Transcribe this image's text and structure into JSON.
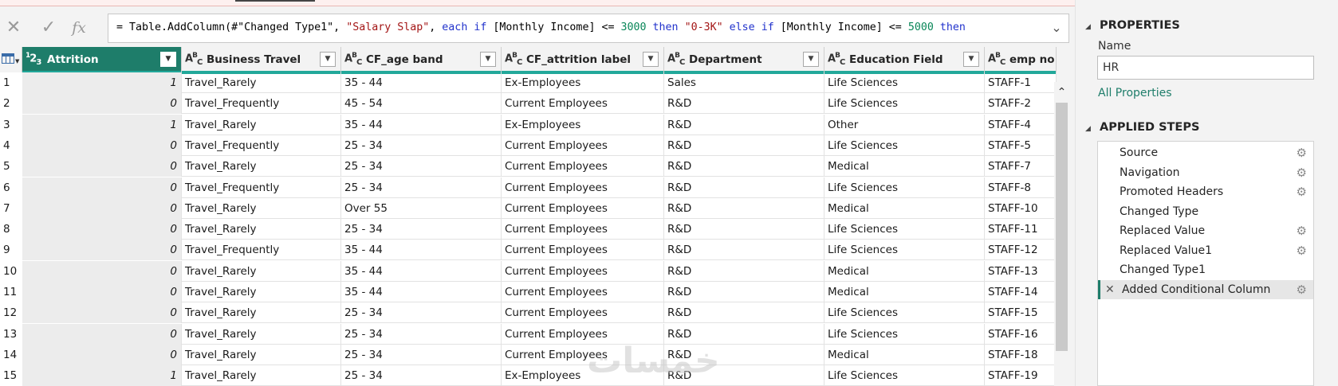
{
  "formula": {
    "segments": [
      {
        "t": "= Table.AddColumn(#\"Changed Type1\", ",
        "c": ""
      },
      {
        "t": "\"Salary Slap\"",
        "c": "str"
      },
      {
        "t": ", ",
        "c": ""
      },
      {
        "t": "each",
        "c": "kw"
      },
      {
        "t": " ",
        "c": ""
      },
      {
        "t": "if",
        "c": "kw"
      },
      {
        "t": " [Monthly Income] <= ",
        "c": ""
      },
      {
        "t": "3000",
        "c": "num"
      },
      {
        "t": " ",
        "c": ""
      },
      {
        "t": "then",
        "c": "kw"
      },
      {
        "t": " ",
        "c": ""
      },
      {
        "t": "\"0-3K\"",
        "c": "str"
      },
      {
        "t": " ",
        "c": ""
      },
      {
        "t": "else",
        "c": "kw"
      },
      {
        "t": " ",
        "c": ""
      },
      {
        "t": "if",
        "c": "kw"
      },
      {
        "t": " [Monthly Income] <= ",
        "c": ""
      },
      {
        "t": "5000",
        "c": "num"
      },
      {
        "t": " ",
        "c": ""
      },
      {
        "t": "then",
        "c": "kw"
      }
    ],
    "fx_label": "fx",
    "cancel_icon": "close-icon",
    "confirm_icon": "check-icon"
  },
  "columns": [
    {
      "type": "123",
      "name": "Attrition",
      "width": 200,
      "selected": true
    },
    {
      "type": "ABC",
      "name": "Business Travel",
      "width": 200
    },
    {
      "type": "ABC",
      "name": "CF_age band",
      "width": 201
    },
    {
      "type": "ABC",
      "name": "CF_attrition label",
      "width": 204
    },
    {
      "type": "ABC",
      "name": "Department",
      "width": 201
    },
    {
      "type": "ABC",
      "name": "Education Field",
      "width": 201
    },
    {
      "type": "ABC",
      "name": "emp no",
      "width": 90
    }
  ],
  "rows": [
    [
      "1",
      "1",
      "Travel_Rarely",
      "35 - 44",
      "Ex-Employees",
      "Sales",
      "Life Sciences",
      "STAFF-1"
    ],
    [
      "2",
      "0",
      "Travel_Frequently",
      "45 - 54",
      "Current Employees",
      "R&D",
      "Life Sciences",
      "STAFF-2"
    ],
    [
      "3",
      "1",
      "Travel_Rarely",
      "35 - 44",
      "Ex-Employees",
      "R&D",
      "Other",
      "STAFF-4"
    ],
    [
      "4",
      "0",
      "Travel_Frequently",
      "25 - 34",
      "Current Employees",
      "R&D",
      "Life Sciences",
      "STAFF-5"
    ],
    [
      "5",
      "0",
      "Travel_Rarely",
      "25 - 34",
      "Current Employees",
      "R&D",
      "Medical",
      "STAFF-7"
    ],
    [
      "6",
      "0",
      "Travel_Frequently",
      "25 - 34",
      "Current Employees",
      "R&D",
      "Life Sciences",
      "STAFF-8"
    ],
    [
      "7",
      "0",
      "Travel_Rarely",
      "Over 55",
      "Current Employees",
      "R&D",
      "Medical",
      "STAFF-10"
    ],
    [
      "8",
      "0",
      "Travel_Rarely",
      "25 - 34",
      "Current Employees",
      "R&D",
      "Life Sciences",
      "STAFF-11"
    ],
    [
      "9",
      "0",
      "Travel_Frequently",
      "35 - 44",
      "Current Employees",
      "R&D",
      "Life Sciences",
      "STAFF-12"
    ],
    [
      "10",
      "0",
      "Travel_Rarely",
      "35 - 44",
      "Current Employees",
      "R&D",
      "Medical",
      "STAFF-13"
    ],
    [
      "11",
      "0",
      "Travel_Rarely",
      "35 - 44",
      "Current Employees",
      "R&D",
      "Medical",
      "STAFF-14"
    ],
    [
      "12",
      "0",
      "Travel_Rarely",
      "25 - 34",
      "Current Employees",
      "R&D",
      "Life Sciences",
      "STAFF-15"
    ],
    [
      "13",
      "0",
      "Travel_Rarely",
      "25 - 34",
      "Current Employees",
      "R&D",
      "Life Sciences",
      "STAFF-16"
    ],
    [
      "14",
      "0",
      "Travel_Rarely",
      "25 - 34",
      "Current Employees",
      "R&D",
      "Medical",
      "STAFF-18"
    ],
    [
      "15",
      "1",
      "Travel_Rarely",
      "25 - 34",
      "Ex-Employees",
      "R&D",
      "Life Sciences",
      "STAFF-19"
    ]
  ],
  "properties": {
    "title": "PROPERTIES",
    "name_label": "Name",
    "name_value": "HR",
    "all_properties": "All Properties"
  },
  "applied_steps": {
    "title": "APPLIED STEPS",
    "steps": [
      {
        "label": "Source",
        "gear": true
      },
      {
        "label": "Navigation",
        "gear": true
      },
      {
        "label": "Promoted Headers",
        "gear": true
      },
      {
        "label": "Changed Type",
        "gear": false
      },
      {
        "label": "Replaced Value",
        "gear": true
      },
      {
        "label": "Replaced Value1",
        "gear": true
      },
      {
        "label": "Changed Type1",
        "gear": false
      },
      {
        "label": "Added Conditional Column",
        "gear": true,
        "active": true
      }
    ]
  },
  "watermark": "خمسات",
  "colors": {
    "accent": "#1e7d6a",
    "column_quality_bar": "#22a89a"
  }
}
